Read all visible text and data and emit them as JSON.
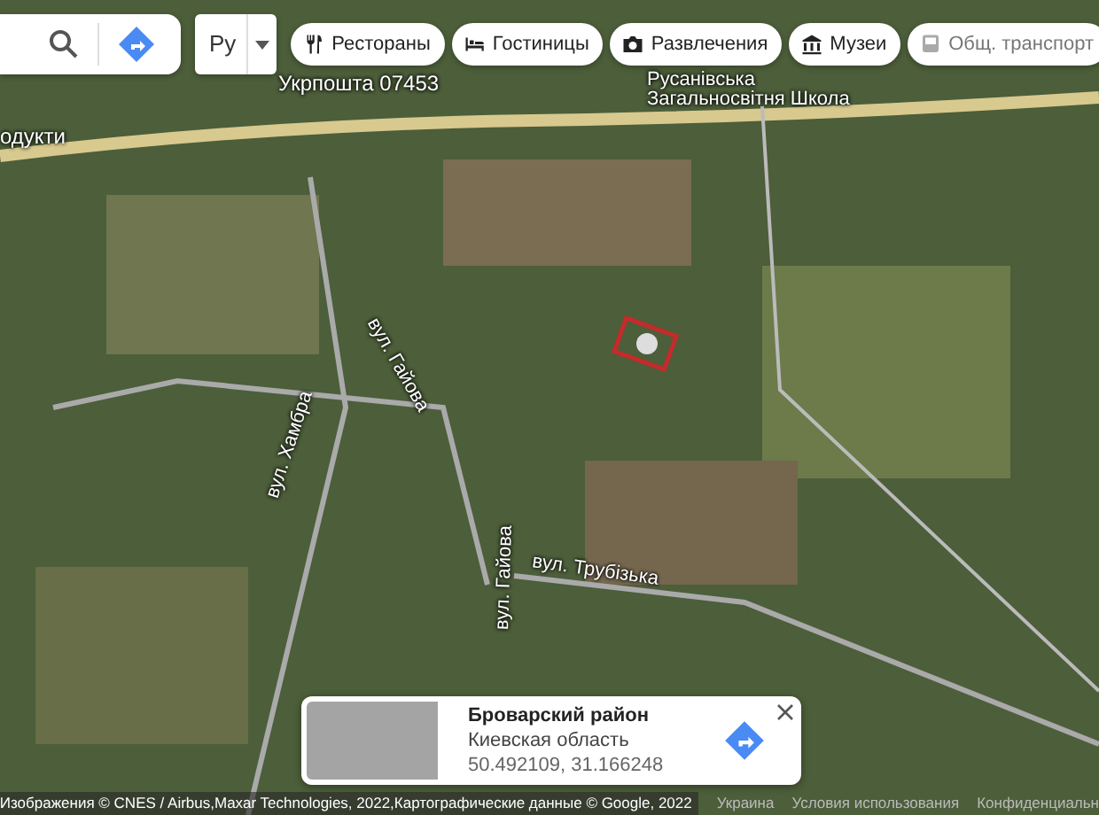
{
  "search": {
    "language": "Ру"
  },
  "chips": [
    {
      "label": "Рестораны",
      "kind": "food"
    },
    {
      "label": "Гостиницы",
      "kind": "hotel"
    },
    {
      "label": "Развлечения",
      "kind": "camera"
    },
    {
      "label": "Музеи",
      "kind": "museum"
    },
    {
      "label": "Общ. транспорт",
      "kind": "transit"
    }
  ],
  "map_labels": [
    {
      "text": "одукти",
      "kind": "place"
    },
    {
      "text": "Укрпошта 07453",
      "kind": "place"
    },
    {
      "text": "Русанівська Загальносвітня Школа",
      "kind": "place"
    },
    {
      "text": "вул. Хамбра",
      "kind": "street"
    },
    {
      "text": "вул. Гайова",
      "kind": "street"
    },
    {
      "text": "вул. Трубізька",
      "kind": "street"
    },
    {
      "text": "вул. Гайова",
      "kind": "street"
    }
  ],
  "info_card": {
    "title": "Броварский район",
    "subtitle": "Киевская область",
    "coordinates": "50.492109, 31.166248"
  },
  "footer": {
    "attribution": "Изображения © CNES / Airbus,Maxar Technologies, 2022,Картографические данные © Google, 2022",
    "links": [
      "Украина",
      "Условия использования",
      "Конфиденциальн"
    ]
  }
}
